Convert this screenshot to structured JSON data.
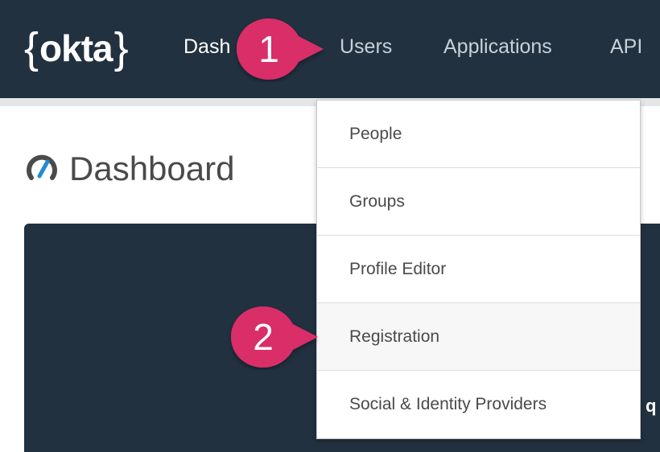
{
  "header": {
    "logo": {
      "left_brace": "{",
      "text": "okta",
      "right_brace": "}"
    },
    "nav": [
      {
        "label": "Dashboard",
        "visible_text": "Dash"
      },
      {
        "label": "Users"
      },
      {
        "label": "Applications"
      },
      {
        "label": "API"
      }
    ]
  },
  "page": {
    "title": "Dashboard",
    "title_icon": "speedometer-icon",
    "panel_peek_text": "q"
  },
  "users_menu": {
    "items": [
      {
        "label": "People"
      },
      {
        "label": "Groups"
      },
      {
        "label": "Profile Editor"
      },
      {
        "label": "Registration",
        "highlighted": true
      },
      {
        "label": "Social & Identity Providers"
      }
    ]
  },
  "annotations": {
    "callouts": [
      {
        "number": "1",
        "points_to": "Users"
      },
      {
        "number": "2",
        "points_to": "Registration"
      }
    ],
    "callout_color": "#d92e67"
  },
  "colors": {
    "topbar": "#213140",
    "callout": "#d92e67",
    "icon_accent": "#1f8cd6"
  }
}
